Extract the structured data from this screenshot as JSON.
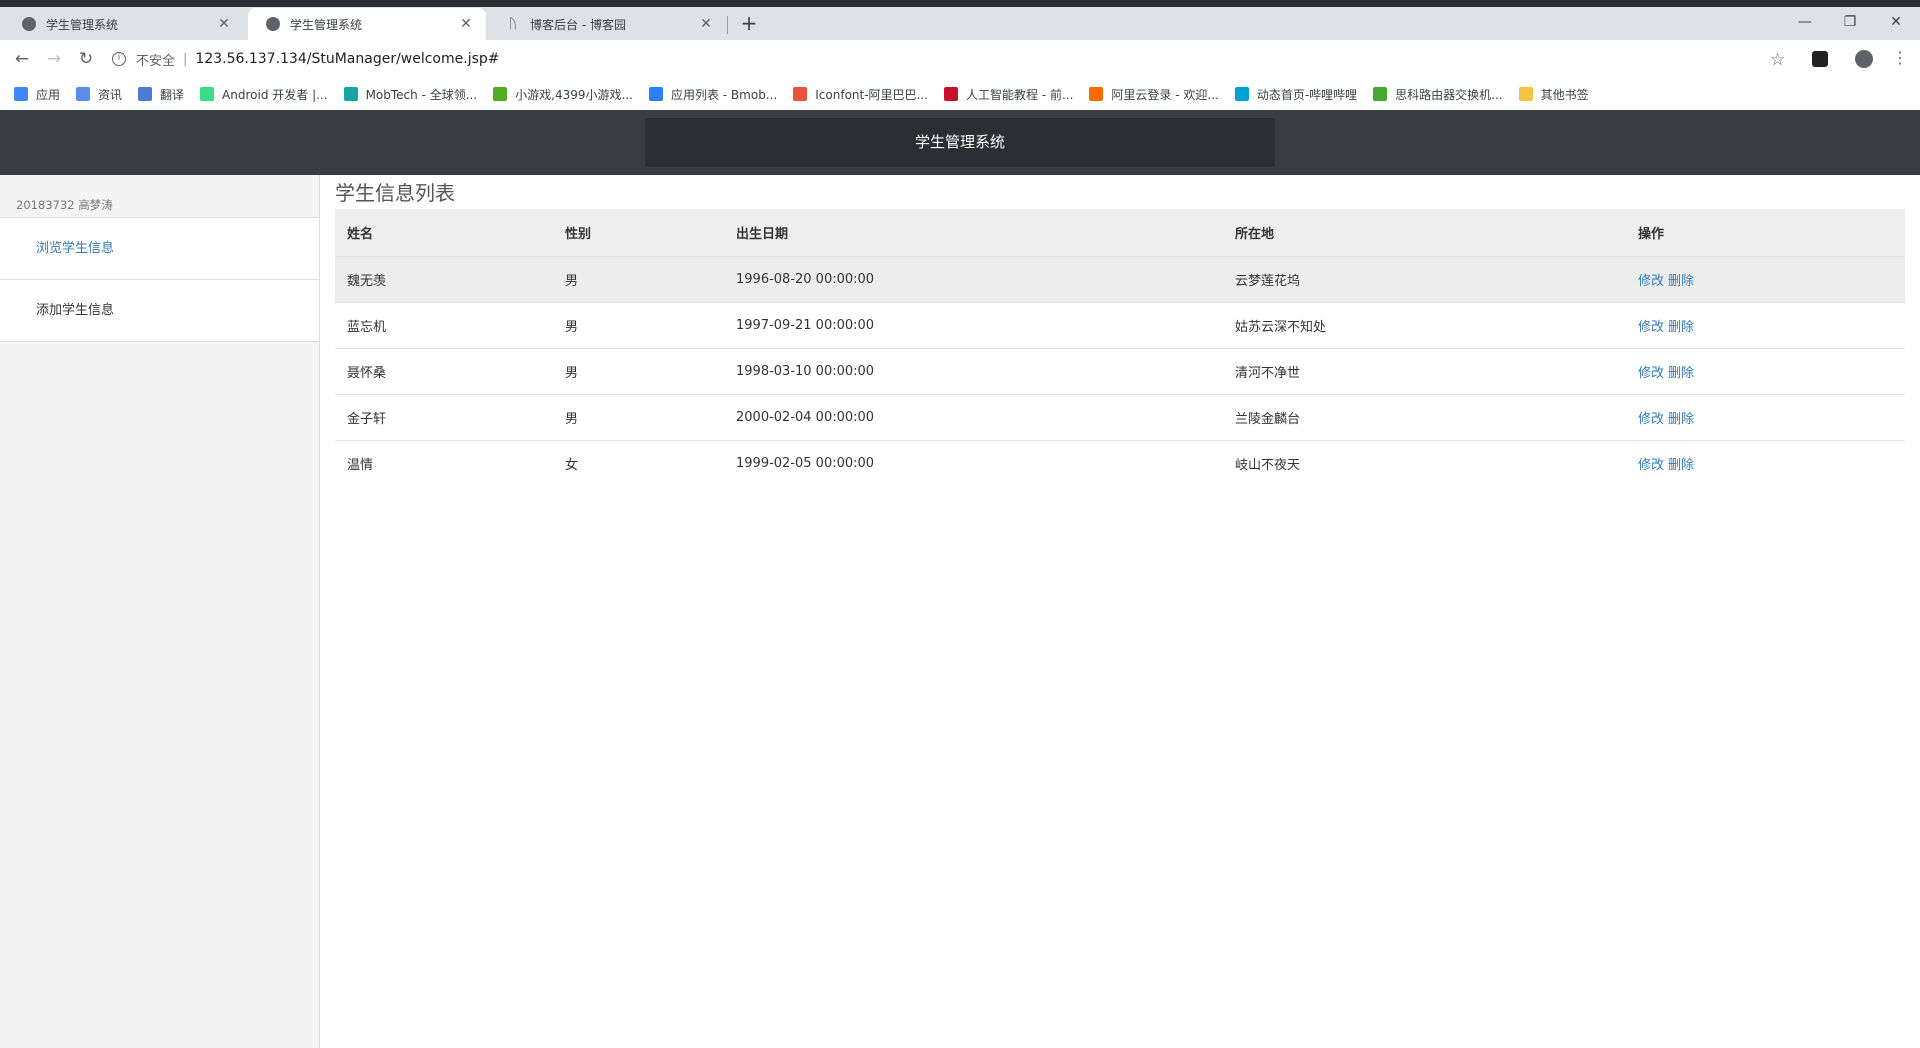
{
  "browser": {
    "tabs": [
      {
        "title": "学生管理系统",
        "active": false
      },
      {
        "title": "学生管理系统",
        "active": true
      },
      {
        "title": "博客后台 - 博客园",
        "active": false
      }
    ],
    "address": {
      "security_label": "不安全",
      "separator": "|",
      "url": "123.56.137.134/StuManager/welcome.jsp#"
    },
    "bookmarks": [
      {
        "label": "应用",
        "color": "#4285f4"
      },
      {
        "label": "资讯",
        "color": "#5b8def"
      },
      {
        "label": "翻译",
        "color": "#4a7bd0"
      },
      {
        "label": "Android 开发者 |...",
        "color": "#3ddc84"
      },
      {
        "label": "MobTech - 全球领...",
        "color": "#1aa3a3"
      },
      {
        "label": "小游戏,4399小游戏...",
        "color": "#55aa22"
      },
      {
        "label": "应用列表 - Bmob...",
        "color": "#2d7ff9"
      },
      {
        "label": "Iconfont-阿里巴巴...",
        "color": "#e8533b"
      },
      {
        "label": "人工智能教程 - 前...",
        "color": "#c8102e"
      },
      {
        "label": "阿里云登录 - 欢迎...",
        "color": "#ff6a00"
      },
      {
        "label": "动态首页-哔哩哔哩",
        "color": "#00a1d6"
      },
      {
        "label": "思科路由器交换机...",
        "color": "#44aa33"
      },
      {
        "label": "其他书签",
        "color": "#f4c542"
      }
    ]
  },
  "header": {
    "brand": "学生管理系统"
  },
  "sidebar": {
    "user": "20183732 高梦涛",
    "items": [
      {
        "label": "浏览学生信息",
        "active": true
      },
      {
        "label": "添加学生信息",
        "active": false
      }
    ]
  },
  "main": {
    "title": "学生信息列表",
    "columns": [
      "姓名",
      "性别",
      "出生日期",
      "所在地",
      "操作"
    ],
    "rows": [
      {
        "name": "魏无羡",
        "gender": "男",
        "birth": "1996-08-20 00:00:00",
        "place": "云梦莲花坞"
      },
      {
        "name": "蓝忘机",
        "gender": "男",
        "birth": "1997-09-21 00:00:00",
        "place": "姑苏云深不知处"
      },
      {
        "name": "聂怀桑",
        "gender": "男",
        "birth": "1998-03-10 00:00:00",
        "place": "清河不净世"
      },
      {
        "name": "金子轩",
        "gender": "男",
        "birth": "2000-02-04 00:00:00",
        "place": "兰陵金麟台"
      },
      {
        "name": "温情",
        "gender": "女",
        "birth": "1999-02-05 00:00:00",
        "place": "岐山不夜天"
      }
    ],
    "actions": {
      "edit": "修改",
      "delete": "删除"
    }
  }
}
